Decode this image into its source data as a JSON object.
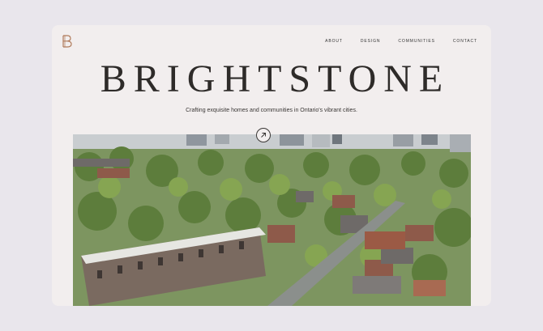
{
  "logo": {
    "letter": "B",
    "icon": "brightstone-logo-icon",
    "color": "#b07a5a"
  },
  "nav": {
    "items": [
      {
        "label": "ABOUT"
      },
      {
        "label": "DESIGN"
      },
      {
        "label": "COMMUNITIES"
      },
      {
        "label": "CONTACT"
      }
    ]
  },
  "hero": {
    "title": "BRIGHTSTONE",
    "tagline": "Crafting exquisite homes and communities in Ontario's vibrant cities.",
    "cta_icon": "arrow-up-right-icon"
  },
  "colors": {
    "page_bg": "#e9e6ec",
    "card_bg": "#f2eeee",
    "text": "#2e2b29"
  }
}
